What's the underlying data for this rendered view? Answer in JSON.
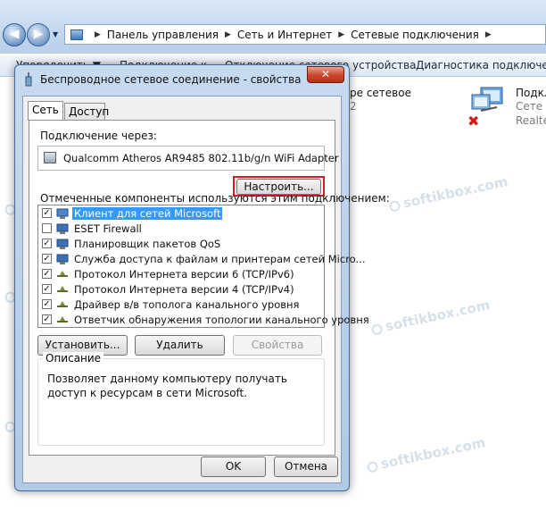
{
  "explorer": {
    "breadcrumbs": [
      "Панель управления",
      "Сеть и Интернет",
      "Сетевые подключения"
    ],
    "toolbar": [
      "Упорядочить ▼",
      "Подключение к",
      "Отключение сетевого устройства",
      "Диагностика подключения"
    ],
    "connections": [
      {
        "name": "ре сетевое",
        "sub": "2"
      },
      {
        "name": "Подкл",
        "sub1": "Сете",
        "sub2": "Realte"
      }
    ]
  },
  "watermark": "softikbox.com",
  "dialog": {
    "title": "Беспроводное сетевое соединение - свойства",
    "close_label": "✕",
    "tabs": [
      "Сеть",
      "Доступ"
    ],
    "connect_via_label": "Подключение через:",
    "adapter_name": "Qualcomm Atheros AR9485 802.11b/g/n WiFi Adapter",
    "configure_label": "Настроить...",
    "components_label": "Отмеченные компоненты используются этим подключением:",
    "components": [
      {
        "label": "Клиент для сетей Microsoft",
        "checked": true,
        "selected": true,
        "icon": "network-client-icon"
      },
      {
        "label": "ESET Firewall",
        "checked": false,
        "selected": false,
        "icon": "network-service-icon"
      },
      {
        "label": "Планировщик пакетов QoS",
        "checked": true,
        "selected": false,
        "icon": "network-service-icon"
      },
      {
        "label": "Служба доступа к файлам и принтерам сетей Micro...",
        "checked": true,
        "selected": false,
        "icon": "network-service-icon"
      },
      {
        "label": "Протокол Интернета версии 6 (TCP/IPv6)",
        "checked": true,
        "selected": false,
        "icon": "protocol-icon"
      },
      {
        "label": "Протокол Интернета версии 4 (TCP/IPv4)",
        "checked": true,
        "selected": false,
        "icon": "protocol-icon"
      },
      {
        "label": "Драйвер в/в тополога канального уровня",
        "checked": true,
        "selected": false,
        "icon": "protocol-icon"
      },
      {
        "label": "Ответчик обнаружения топологии канального уровня",
        "checked": true,
        "selected": false,
        "icon": "protocol-icon"
      }
    ],
    "install_label": "Установить...",
    "remove_label": "Удалить",
    "properties_label": "Свойства",
    "description_heading": "Описание",
    "description_text": "Позволяет данному компьютеру получать доступ к ресурсам в сети Microsoft.",
    "ok_label": "OK",
    "cancel_label": "Отмена"
  },
  "colors": {
    "selection": "#3399ff",
    "highlight_frame": "#d21f26",
    "close_button": "#c9452a"
  }
}
